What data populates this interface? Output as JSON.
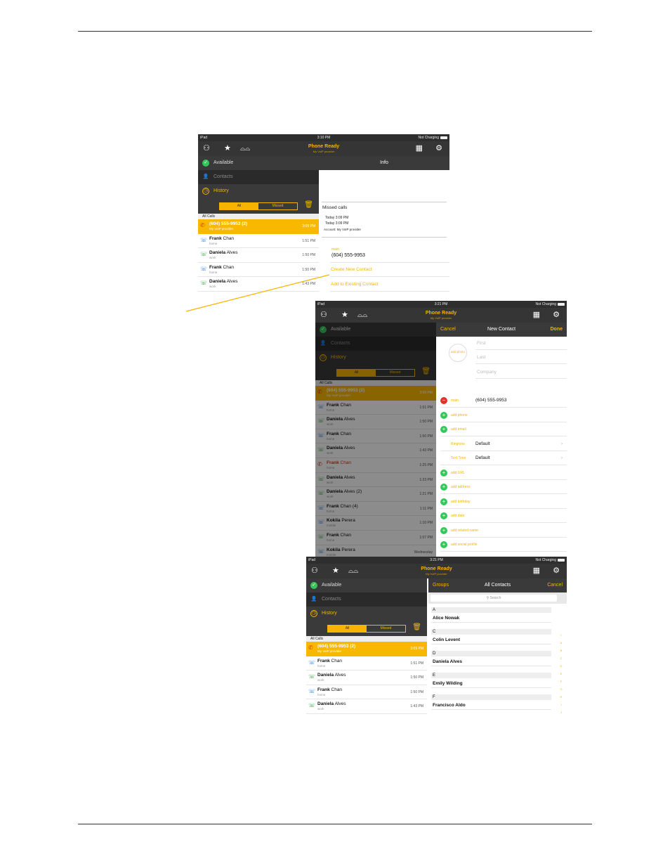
{
  "screen1": {
    "status": {
      "device": "iPad",
      "time": "3:10 PM",
      "battery": "Not Charging"
    },
    "app_title": "Phone Ready",
    "app_subtitle": "My VoIP provider",
    "nav": {
      "available": "Available",
      "contacts": "Contacts",
      "history": "History"
    },
    "segment": {
      "all": "All",
      "missed": "Missed"
    },
    "section": "All Calls",
    "calls": [
      {
        "name_first": "(604) 555-9953",
        "name_last": "(2)",
        "sub": "My VoIP provider",
        "time": "3:09 PM",
        "type": "missed",
        "highlight": true
      },
      {
        "name_first": "Frank",
        "name_last": "Chan",
        "sub": "home",
        "time": "1:51 PM",
        "type": "outgoing"
      },
      {
        "name_first": "Daniela",
        "name_last": "Alves",
        "sub": "work",
        "time": "1:50 PM",
        "type": "incoming"
      },
      {
        "name_first": "Frank",
        "name_last": "Chan",
        "sub": "home",
        "time": "1:50 PM",
        "type": "outgoing"
      },
      {
        "name_first": "Daniela",
        "name_last": "Alves",
        "sub": "work",
        "time": "1:43 PM",
        "type": "incoming"
      }
    ],
    "info": {
      "header": "Info",
      "missed_title": "Missed calls",
      "missed_1": "Today 3:09 PM",
      "missed_2": "Today 3:09 PM",
      "account": "Account: My VoIP provider",
      "phone_label": "main",
      "phone_value": "(604) 555-9953",
      "create": "Create New Contact",
      "add_existing": "Add to Existing Contact"
    }
  },
  "screen2": {
    "status": {
      "device": "iPad",
      "time": "3:21 PM",
      "battery": "Not Charging"
    },
    "app_title": "Phone Ready",
    "app_subtitle": "My VoIP provider",
    "nav": {
      "available": "Available",
      "contacts": "Contacts",
      "history": "History"
    },
    "segment": {
      "all": "All",
      "missed": "Missed"
    },
    "section": "All Calls",
    "calls": [
      {
        "name_first": "(604) 555-9953",
        "name_last": "(2)",
        "sub": "My VoIP provider",
        "time": "3:09 PM",
        "type": "missed",
        "highlight": true
      },
      {
        "name_first": "Frank",
        "name_last": "Chan",
        "sub": "home",
        "time": "1:51 PM",
        "type": "outgoing"
      },
      {
        "name_first": "Daniela",
        "name_last": "Alves",
        "sub": "work",
        "time": "1:50 PM",
        "type": "incoming"
      },
      {
        "name_first": "Frank",
        "name_last": "Chan",
        "sub": "home",
        "time": "1:50 PM",
        "type": "outgoing"
      },
      {
        "name_first": "Daniela",
        "name_last": "Alves",
        "sub": "work",
        "time": "1:43 PM",
        "type": "incoming"
      },
      {
        "name_first": "Frank",
        "name_last": "Chan",
        "sub": "home",
        "time": "1:25 PM",
        "type": "missed"
      },
      {
        "name_first": "Daniela",
        "name_last": "Alves",
        "sub": "work",
        "time": "1:23 PM",
        "type": "incoming"
      },
      {
        "name_first": "Daniela",
        "name_last": "Alves (2)",
        "sub": "work",
        "time": "1:21 PM",
        "type": "incoming"
      },
      {
        "name_first": "Frank",
        "name_last": "Chan (4)",
        "sub": "home",
        "time": "1:11 PM",
        "type": "outgoing"
      },
      {
        "name_first": "Kokila",
        "name_last": "Perera",
        "sub": "mobile",
        "time": "1:10 PM",
        "type": "outgoing"
      },
      {
        "name_first": "Frank",
        "name_last": "Chan",
        "sub": "home",
        "time": "1:07 PM",
        "type": "incoming"
      },
      {
        "name_first": "Kokila",
        "name_last": "Perera",
        "sub": "mobile",
        "time": "Wednesday",
        "type": "outgoing"
      }
    ],
    "new_contact": {
      "cancel": "Cancel",
      "title": "New Contact",
      "done": "Done",
      "add_photo": "add photo",
      "first": "First",
      "last": "Last",
      "company": "Company",
      "phone_label": "main",
      "phone_value": "(604) 555-9953",
      "add_phone": "add phone",
      "add_email": "add email",
      "ringtone_label": "Ringtone",
      "ringtone_value": "Default",
      "texttone_label": "Text Tone",
      "texttone_value": "Default",
      "add_url": "add URL",
      "add_address": "add address",
      "add_birthday": "add birthday",
      "add_date": "add date",
      "add_related": "add related name",
      "add_social": "add social profile"
    }
  },
  "screen3": {
    "status": {
      "device": "iPad",
      "time": "3:21 PM",
      "battery": "Not Charging"
    },
    "app_title": "Phone Ready",
    "app_subtitle": "My VoIP provider",
    "nav": {
      "available": "Available",
      "contacts": "Contacts",
      "history": "History"
    },
    "segment": {
      "all": "All",
      "missed": "Missed"
    },
    "section": "All Calls",
    "calls": [
      {
        "name_first": "(604) 555-9953",
        "name_last": "(2)",
        "sub": "My VoIP provider",
        "time": "3:09 PM",
        "type": "missed",
        "highlight": true
      },
      {
        "name_first": "Frank",
        "name_last": "Chan",
        "sub": "home",
        "time": "1:51 PM",
        "type": "outgoing"
      },
      {
        "name_first": "Daniela",
        "name_last": "Alves",
        "sub": "work",
        "time": "1:50 PM",
        "type": "incoming"
      },
      {
        "name_first": "Frank",
        "name_last": "Chan",
        "sub": "home",
        "time": "1:50 PM",
        "type": "outgoing"
      },
      {
        "name_first": "Daniela",
        "name_last": "Alves",
        "sub": "work",
        "time": "1:43 PM",
        "type": "incoming"
      }
    ],
    "contacts": {
      "groups": "Groups",
      "title": "All Contacts",
      "cancel": "Cancel",
      "search": "Search",
      "sections": [
        {
          "letter": "A",
          "name": "Alice Nowak"
        },
        {
          "letter": "C",
          "name": "Colin Levent"
        },
        {
          "letter": "D",
          "name": "Daniela Alves"
        },
        {
          "letter": "E",
          "name": "Emily Wilding"
        },
        {
          "letter": "F",
          "name": "Francisco Aldo"
        }
      ],
      "index": [
        "☆",
        "A",
        "B",
        "C",
        "D",
        "E",
        "F",
        "G",
        "H",
        "I",
        "J"
      ]
    }
  },
  "colors": {
    "accent": "#f5b400",
    "toolbar": "#353535",
    "available": "#34c759",
    "missed": "#d9341e"
  }
}
